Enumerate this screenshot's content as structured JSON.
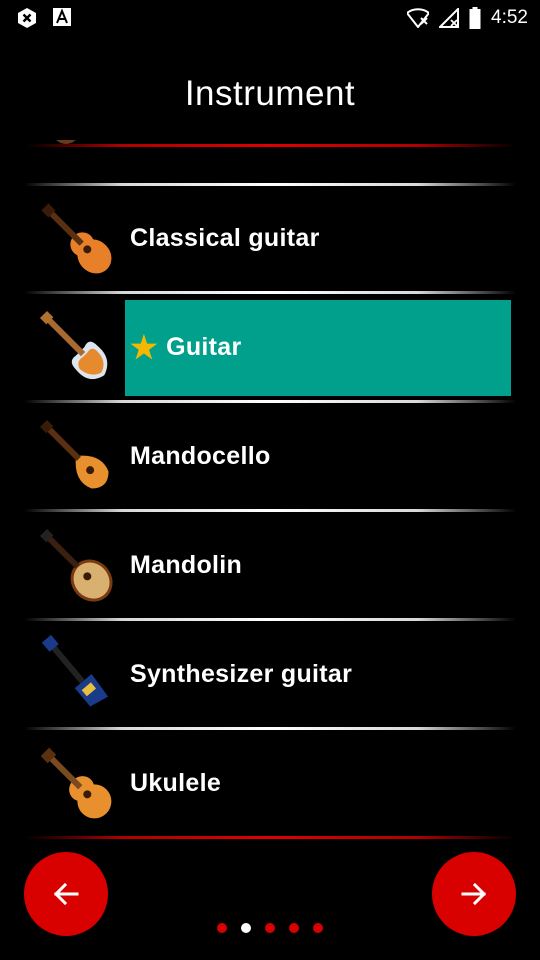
{
  "status_bar": {
    "time": "4:52",
    "icons": [
      "close-box-icon",
      "font-box-icon",
      "wifi-icon",
      "signal-icon",
      "battery-icon"
    ]
  },
  "page": {
    "title": "Instrument"
  },
  "list": {
    "items": [
      {
        "label": "Classical guitar",
        "icon": "classical-guitar-icon",
        "selected": false
      },
      {
        "label": "Guitar",
        "icon": "electric-bass-icon",
        "selected": true
      },
      {
        "label": "Mandocello",
        "icon": "mandocello-icon",
        "selected": false
      },
      {
        "label": "Mandolin",
        "icon": "mandolin-icon",
        "selected": false
      },
      {
        "label": "Synthesizer guitar",
        "icon": "synthesizer-guitar-icon",
        "selected": false
      },
      {
        "label": "Ukulele",
        "icon": "ukulele-icon",
        "selected": false
      }
    ]
  },
  "navigation": {
    "prev_icon": "arrow-left-icon",
    "next_icon": "arrow-right-icon",
    "page_count": 5,
    "current_page": 2
  },
  "colors": {
    "accent": "#d90000",
    "selection": "#00a08c",
    "star": "#f5b800",
    "background": "#000000"
  }
}
